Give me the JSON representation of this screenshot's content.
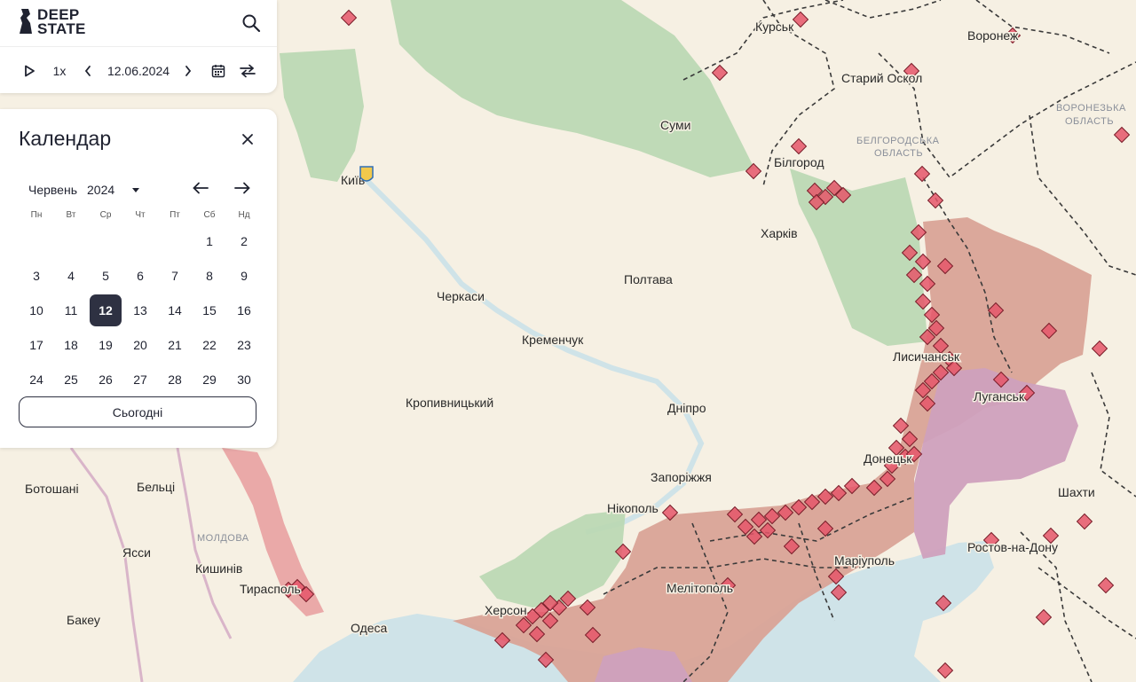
{
  "app": {
    "logo_line1": "DEEP",
    "logo_line2": "STATE"
  },
  "timeline": {
    "speed": "1x",
    "date": "12.06.2024"
  },
  "calendar": {
    "title": "Календар",
    "month": "Червень",
    "year": "2024",
    "weekdays": [
      "Пн",
      "Вт",
      "Ср",
      "Чт",
      "Пт",
      "Сб",
      "Нд"
    ],
    "days": [
      "1",
      "2",
      "3",
      "4",
      "5",
      "6",
      "7",
      "8",
      "9",
      "10",
      "11",
      "12",
      "13",
      "14",
      "15",
      "16",
      "17",
      "18",
      "19",
      "20",
      "21",
      "22",
      "23",
      "24",
      "25",
      "26",
      "27",
      "28",
      "29",
      "30"
    ],
    "selected_day": "12",
    "today_label": "Сьогодні"
  },
  "map": {
    "cities": {
      "kursk": "Курськ",
      "voronezh": "Воронеж",
      "stary_oskol": "Старий Оскол",
      "sumy": "Суми",
      "belgorod": "Білгород",
      "kyiv": "Київ",
      "kharkiv": "Харків",
      "poltava": "Полтава",
      "cherkasy": "Черкаси",
      "kremenchuk": "Кременчук",
      "lysychansk": "Лисичанськ",
      "luhansk": "Луганськ",
      "kropyvnytskyi": "Кропивницький",
      "dnipro": "Дніпро",
      "donetsk": "Донецьк",
      "zaporizhzhia": "Запоріжжя",
      "shakhty": "Шахти",
      "botoshani": "Ботошані",
      "beltsi": "Бельці",
      "nikopol": "Нікополь",
      "iasi": "Ясси",
      "chisinau": "Кишинів",
      "rostov": "Ростов-на-Дону",
      "mariupol": "Маріуполь",
      "tiraspol": "Тирасполь",
      "kherson": "Херсон",
      "melitopol": "Мелітополь",
      "bacau": "Бакеу",
      "odesa": "Одеса"
    },
    "regions": {
      "voronezh_l1": "ВОРОНЕЗЬКА",
      "voronezh_l2": "ОБЛАСТЬ",
      "belgorod_l1": "БЕЛГОРОДСЬКА",
      "belgorod_l2": "ОБЛАСТЬ",
      "moldova": "МОЛДОВА"
    },
    "colors": {
      "land": "#f6f0e3",
      "sea": "#cfe3e8",
      "occupied": "#d9a397",
      "occupied_pre2022": "#cfa0bd",
      "liberated": "#b9d7b1",
      "transnistria": "#e9a4a4",
      "marker": "#e5566a"
    }
  }
}
